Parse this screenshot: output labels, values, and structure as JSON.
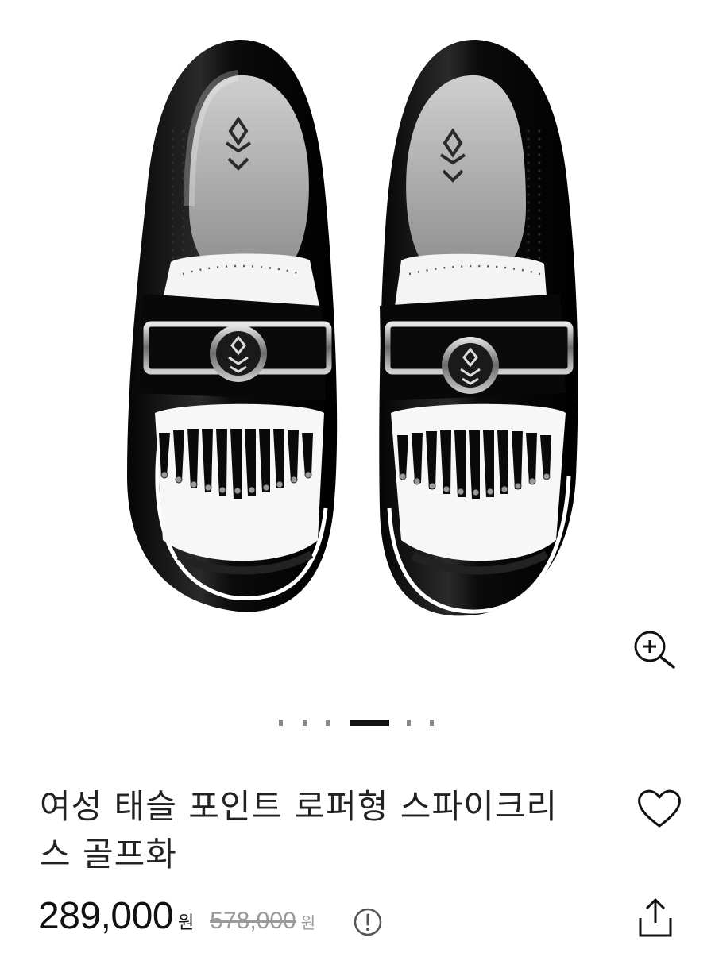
{
  "product": {
    "title_line1": "여성 태슬 포인트 로퍼형 스파이크리",
    "title_line2": "스 골프화",
    "price": "289,000",
    "price_unit": "원",
    "original_price": "578,000",
    "original_unit": "원"
  },
  "gallery": {
    "image_alt": "black and white tassel loafer golf shoes",
    "page_indicator": {
      "total": 6,
      "active_index": 3
    }
  },
  "icons": {
    "zoom": "zoom-in-icon",
    "wishlist": "heart-icon",
    "info": "info-icon",
    "share": "share-icon"
  },
  "colors": {
    "text": "#222222",
    "strike": "#9a9a9a",
    "active_dot": "#111111",
    "inactive_dot": "#8a8a8a"
  }
}
